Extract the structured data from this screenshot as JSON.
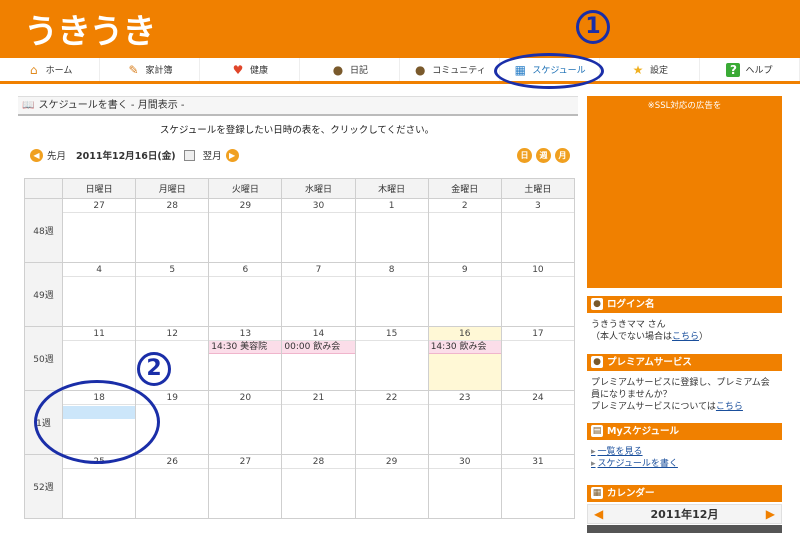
{
  "header": {
    "logo": "うきうき"
  },
  "nav": {
    "items": [
      {
        "label": "ホーム",
        "icon": "home-icon",
        "glyph": "⌂"
      },
      {
        "label": "家計簿",
        "icon": "pencil-icon",
        "glyph": "✎"
      },
      {
        "label": "健康",
        "icon": "heart-icon",
        "glyph": "♥"
      },
      {
        "label": "日記",
        "icon": "person-icon",
        "glyph": "●"
      },
      {
        "label": "コミュニティ",
        "icon": "group-icon",
        "glyph": "●"
      },
      {
        "label": "スケジュール",
        "icon": "calendar-icon",
        "glyph": "▦"
      },
      {
        "label": "設定",
        "icon": "star-icon",
        "glyph": "★"
      },
      {
        "label": "ヘルプ",
        "icon": "help-icon",
        "glyph": "?"
      }
    ]
  },
  "main": {
    "title": "スケジュールを書く - 月間表示 -",
    "instruction": "スケジュールを登録したい日時の表を、クリックしてください。",
    "prev_label": "先月",
    "current_date": "2011年12月16日(金)",
    "next_label": "翌月",
    "view_day": "日",
    "view_week": "週",
    "view_month": "月"
  },
  "calendar": {
    "headers": [
      "日曜日",
      "月曜日",
      "火曜日",
      "水曜日",
      "木曜日",
      "金曜日",
      "土曜日"
    ],
    "weeks": [
      {
        "label": "48週",
        "days": [
          "27",
          "28",
          "29",
          "30",
          "1",
          "2",
          "3"
        ]
      },
      {
        "label": "49週",
        "days": [
          "4",
          "5",
          "6",
          "7",
          "8",
          "9",
          "10"
        ]
      },
      {
        "label": "50週",
        "days": [
          "11",
          "12",
          "13",
          "14",
          "15",
          "16",
          "17"
        ]
      },
      {
        "label": "1週",
        "days": [
          "18",
          "19",
          "20",
          "21",
          "22",
          "23",
          "24"
        ]
      },
      {
        "label": "52週",
        "days": [
          "25",
          "26",
          "27",
          "28",
          "29",
          "30",
          "31"
        ]
      }
    ],
    "events": {
      "tue_13": "14:30 美容院",
      "wed_14": "00:00 飲み会",
      "fri_16": "14:30 飲み会"
    }
  },
  "annotations": {
    "one": "1",
    "two": "2",
    "color": "#1a2ea8"
  },
  "sidebar": {
    "ad_label": "※SSL対応の広告を",
    "login": {
      "title": "ログイン名",
      "user": "うきうきママ さん",
      "not_you_prefix": "（本人でない場合は",
      "not_you_link": "こちら",
      "not_you_suffix": "）"
    },
    "premium": {
      "title": "プレミアムサービス",
      "line1": "プレミアムサービスに登録し、プレミアム会員になりませんか？",
      "line2_prefix": "プレミアムサービスについては",
      "line2_link": "こちら"
    },
    "my_schedule": {
      "title": "Myスケジュール",
      "link1": "一覧を見る",
      "link2": "スケジュールを書く"
    },
    "calendar": {
      "title": "カレンダー",
      "year_month": "2011年12月"
    }
  },
  "colors": {
    "accent": "#f08000",
    "event_bg": "#fbdde9",
    "today_bg": "#fff8d6",
    "selected_bg": "#cce6fa"
  }
}
